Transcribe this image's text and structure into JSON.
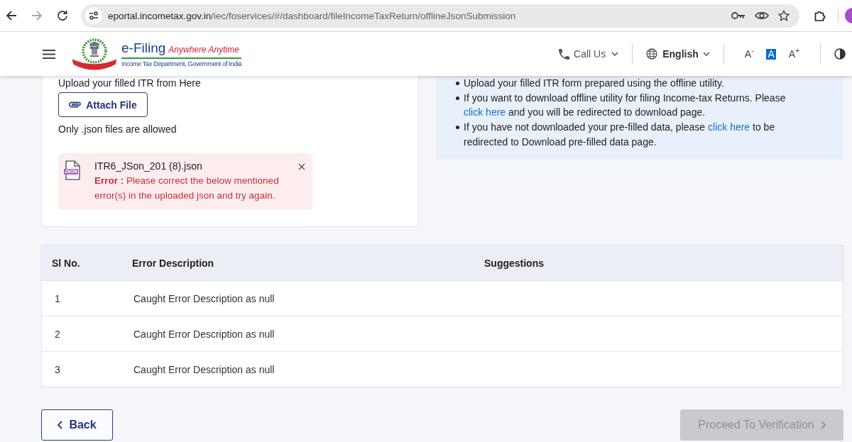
{
  "browser": {
    "nav": [
      {
        "kind": "back",
        "disabled": false
      },
      {
        "kind": "forward",
        "disabled": true
      },
      {
        "kind": "reload",
        "disabled": false
      }
    ],
    "url_host": "eportal.incometax.gov.in",
    "url_path": "/iec/foservices/#/dashboard/fileIncomeTaxReturn/offlineJsonSubmission"
  },
  "header": {
    "logo": {
      "title": "e-Filing",
      "tagline": "Anywhere Anytime",
      "subtitle": "Income Tax Department, Government of India"
    },
    "call_us": "Call Us",
    "language": "English",
    "text_sizes": [
      {
        "label": "A$^{-}$",
        "selected": false
      },
      {
        "label": "A",
        "selected": true
      },
      {
        "label": "A$^{+}$",
        "selected": false
      }
    ]
  },
  "upload": {
    "instruction": "Upload your filled ITR from Here",
    "attach_button": "Attach File",
    "hint": "Only .json files are allowed",
    "file": {
      "type_label": "JSON",
      "name": "ITR6_JSon_201 (8).json",
      "error": "**Error :** Please correct the below mentioned error(s) in the uploaded json and try again."
    }
  },
  "info": {
    "bullets": [
      {
        "parts": [
          {
            "kind": "text",
            "text": "Upload your filled ITR form prepared using the offline utility."
          }
        ]
      },
      {
        "parts": [
          {
            "kind": "text",
            "text": "If you want to download offline utility for filing Income-tax Returns. Please "
          },
          {
            "kind": "link",
            "text": "click here"
          },
          {
            "kind": "text",
            "text": " and you will be redirected to download page."
          }
        ]
      },
      {
        "parts": [
          {
            "kind": "text",
            "text": "If you have not downloaded your pre-filled data, please "
          },
          {
            "kind": "link",
            "text": "click here"
          },
          {
            "kind": "text",
            "text": " to be redirected to Download pre-filled data page."
          }
        ]
      }
    ]
  },
  "table": {
    "columns": [
      "Sl No.",
      "Error Description",
      "Suggestions"
    ],
    "rows": [
      {
        "sl_no": "1",
        "error_description": "Caught Error Description as null"
      },
      {
        "sl_no": "2",
        "error_description": "Caught Error Description as null"
      },
      {
        "sl_no": "3",
        "error_description": "Caught Error Description as null"
      }
    ]
  },
  "footer": {
    "back_button": "Back",
    "proceed_button": {
      "label": "Proceed To Verification",
      "disabled": true
    }
  }
}
